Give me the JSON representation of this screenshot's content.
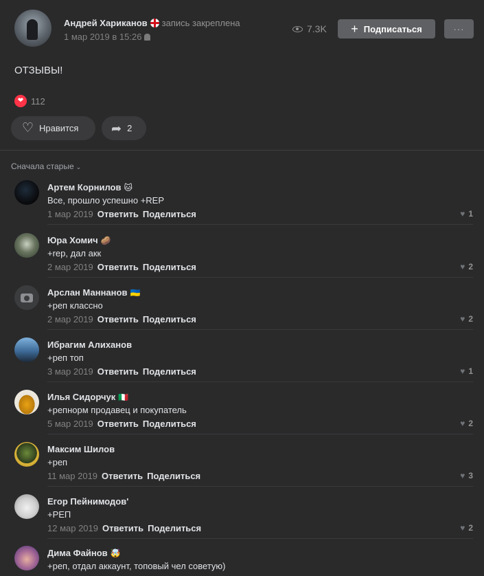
{
  "post": {
    "author_name": "Андрей Хариканов",
    "pinned_label": "запись закреплена",
    "date": "1 мар 2019 в 15:26",
    "views": "7.3K",
    "subscribe_label": "Подписаться",
    "more_label": "···",
    "text": "ОТЗЫВЫ!",
    "reactions_count": "112",
    "like_label": "Нравится",
    "share_count": "2"
  },
  "comments_header": {
    "sort_label": "Сначала старые"
  },
  "comments": [
    {
      "name": "Артем Корнилов",
      "emoji": "🐱",
      "text": "Все, прошло успешно +REP",
      "date": "1 мар 2019",
      "reply": "Ответить",
      "share": "Поделиться",
      "likes": "1"
    },
    {
      "name": "Юра Хомич",
      "emoji": "🥔",
      "text": "+rep, дал акк",
      "date": "2 мар 2019",
      "reply": "Ответить",
      "share": "Поделиться",
      "likes": "2"
    },
    {
      "name": "Арслан Маннанов",
      "emoji": "🇺🇦",
      "text": "+реп классно",
      "date": "2 мар 2019",
      "reply": "Ответить",
      "share": "Поделиться",
      "likes": "2"
    },
    {
      "name": "Ибрагим Алиханов",
      "emoji": "",
      "text": "+реп топ",
      "date": "3 мар 2019",
      "reply": "Ответить",
      "share": "Поделиться",
      "likes": "1"
    },
    {
      "name": "Илья Сидорчук",
      "emoji": "🇮🇹",
      "text": "+репнорм продавец и покупатель",
      "date": "5 мар 2019",
      "reply": "Ответить",
      "share": "Поделиться",
      "likes": "2"
    },
    {
      "name": "Максим Шилов",
      "emoji": "",
      "text": "+реп",
      "date": "11 мар 2019",
      "reply": "Ответить",
      "share": "Поделиться",
      "likes": "3"
    },
    {
      "name": "Егор Пейнимодов'",
      "emoji": "",
      "text": "+РЕП",
      "date": "12 мар 2019",
      "reply": "Ответить",
      "share": "Поделиться",
      "likes": "2"
    },
    {
      "name": "Дима Файнов",
      "emoji": "🤯",
      "text": "+реп, отдал аккаунт, топовый чел советую)",
      "date": "",
      "reply": "",
      "share": "",
      "likes": ""
    }
  ]
}
